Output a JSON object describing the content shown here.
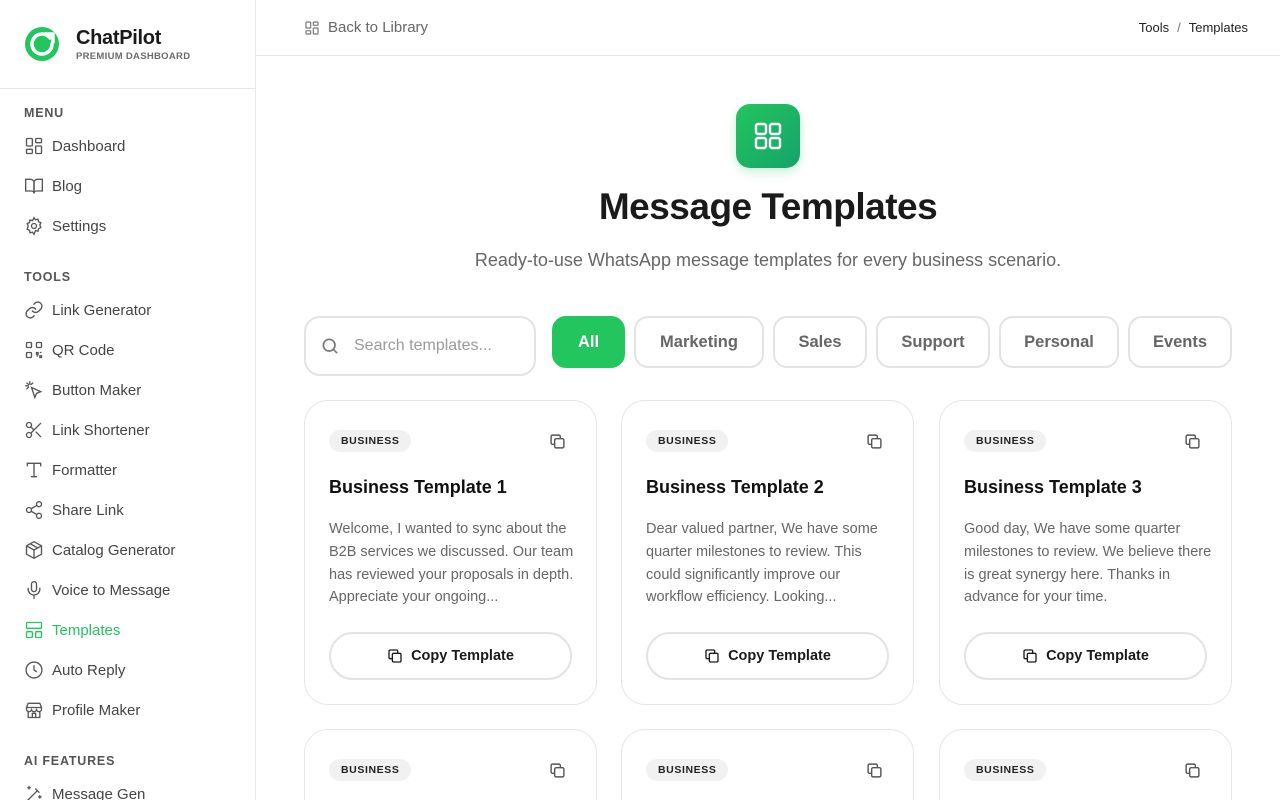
{
  "brand": {
    "name": "ChatPilot",
    "subtitle": "PREMIUM DASHBOARD"
  },
  "sidebar": {
    "sections": [
      {
        "title": "MENU",
        "items": [
          {
            "label": "Dashboard",
            "icon": "dashboard-icon"
          },
          {
            "label": "Blog",
            "icon": "book-icon"
          },
          {
            "label": "Settings",
            "icon": "gear-icon"
          }
        ]
      },
      {
        "title": "TOOLS",
        "items": [
          {
            "label": "Link Generator",
            "icon": "link-icon"
          },
          {
            "label": "QR Code",
            "icon": "qr-code-icon"
          },
          {
            "label": "Button Maker",
            "icon": "pointer-click-icon"
          },
          {
            "label": "Link Shortener",
            "icon": "scissors-icon"
          },
          {
            "label": "Formatter",
            "icon": "type-icon"
          },
          {
            "label": "Share Link",
            "icon": "share-icon"
          },
          {
            "label": "Catalog Generator",
            "icon": "package-icon"
          },
          {
            "label": "Voice to Message",
            "icon": "microphone-icon"
          },
          {
            "label": "Templates",
            "icon": "layout-icon",
            "active": true
          },
          {
            "label": "Auto Reply",
            "icon": "clock-icon"
          },
          {
            "label": "Profile Maker",
            "icon": "store-icon"
          }
        ]
      },
      {
        "title": "AI FEATURES",
        "items": [
          {
            "label": "Message Gen",
            "icon": "magic-wand-icon"
          }
        ]
      }
    ]
  },
  "topbar": {
    "back_label": "Back to Library",
    "breadcrumb": [
      "Tools",
      "/",
      "Templates"
    ]
  },
  "hero": {
    "title": "Message Templates",
    "subtitle": "Ready-to-use WhatsApp message templates for every business scenario."
  },
  "search": {
    "placeholder": "Search templates...",
    "value": ""
  },
  "filters": [
    {
      "label": "All",
      "active": true
    },
    {
      "label": "Marketing"
    },
    {
      "label": "Sales"
    },
    {
      "label": "Support"
    },
    {
      "label": "Personal"
    },
    {
      "label": "Events"
    }
  ],
  "cards": [
    {
      "badge": "BUSINESS",
      "title": "Business Template 1",
      "body": "Welcome, I wanted to sync about the B2B services we discussed. Our team has reviewed your proposals in depth. Appreciate your ongoing...",
      "button": "Copy Template"
    },
    {
      "badge": "BUSINESS",
      "title": "Business Template 2",
      "body": "Dear valued partner, We have some quarter milestones to review. This could significantly improve our workflow efficiency. Looking...",
      "button": "Copy Template"
    },
    {
      "badge": "BUSINESS",
      "title": "Business Template 3",
      "body": "Good day, We have some quarter milestones to review. We believe there is great synergy here. Thanks in advance for your time.",
      "button": "Copy Template"
    },
    {
      "badge": "BUSINESS",
      "title": "",
      "body": "",
      "button": ""
    },
    {
      "badge": "BUSINESS",
      "title": "",
      "body": "",
      "button": ""
    },
    {
      "badge": "BUSINESS",
      "title": "",
      "body": "",
      "button": ""
    }
  ],
  "colors": {
    "accent": "#22c55e",
    "text": "#1a1a1a",
    "muted": "#666666",
    "border": "#e3e3e3"
  }
}
